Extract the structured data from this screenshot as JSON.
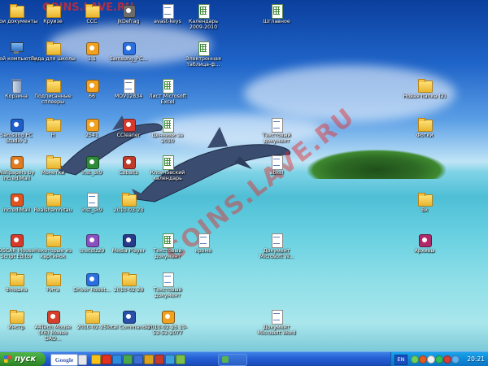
{
  "desktop": {
    "icons": [
      {
        "label": "Мои документы",
        "kind": "folder"
      },
      {
        "label": "Круизе",
        "kind": "folder"
      },
      {
        "label": "ССС",
        "kind": "folder"
      },
      {
        "label": "JkDefrag",
        "kind": "app",
        "color": "#6b6b6b"
      },
      {
        "label": "avast-keys",
        "kind": "doc"
      },
      {
        "label": "Календарь 2009-2010",
        "kind": "xls"
      },
      {
        "label": "Шглавное",
        "kind": "xls"
      },
      {
        "label": "Мой компьютер",
        "kind": "pc"
      },
      {
        "label": "Лида для школы",
        "kind": "folder"
      },
      {
        "label": "1.1",
        "kind": "app",
        "color": "#f2a01f"
      },
      {
        "label": "Samsung_PC...",
        "kind": "app",
        "color": "#2a6fe0"
      },
      {
        "label": "Электронная таблица-ф...",
        "kind": "xls"
      },
      {
        "label": "Корзина",
        "kind": "bin"
      },
      {
        "label": "Подписанные сплееры",
        "kind": "folder"
      },
      {
        "label": "66",
        "kind": "app",
        "color": "#f2a01f"
      },
      {
        "label": "MOV02834",
        "kind": "doc"
      },
      {
        "label": "Лист Microsoft Excel",
        "kind": "xls"
      },
      {
        "label": "Новая папка (2)",
        "kind": "folder"
      },
      {
        "label": "Samsung PC Studio 3",
        "kind": "app",
        "color": "#1f5fc9"
      },
      {
        "label": "Н",
        "kind": "folder"
      },
      {
        "label": "2541",
        "kind": "app",
        "color": "#f2a01f"
      },
      {
        "label": "CCleaner",
        "kind": "app",
        "color": "#d63a2a"
      },
      {
        "label": "Ценники за 2010",
        "kind": "xls"
      },
      {
        "label": "Текстовый документ",
        "kind": "doc"
      },
      {
        "label": "Фотки",
        "kind": "folder"
      },
      {
        "label": "Wallpapers by IncrediMail",
        "kind": "app",
        "color": "#e07b1f"
      },
      {
        "label": "Монетки",
        "kind": "folder"
      },
      {
        "label": "inst_sk9",
        "kind": "app",
        "color": "#2e8b3a"
      },
      {
        "label": "Cobalts",
        "kind": "app",
        "color": "#c03a2a"
      },
      {
        "label": "Клоичэвский календарь",
        "kind": "xls"
      },
      {
        "label": "abkill",
        "kind": "doc"
      },
      {
        "label": "IncrediMail",
        "kind": "app",
        "color": "#e0541f"
      },
      {
        "label": "Realshamnitau",
        "kind": "folder"
      },
      {
        "label": "inst_sk9",
        "kind": "doc"
      },
      {
        "label": "2010-03-23",
        "kind": "folder"
      },
      {
        "label": "Вк",
        "kind": "folder"
      },
      {
        "label": "OSCAR Mouse Script Editor",
        "kind": "app",
        "color": "#d63a2a"
      },
      {
        "label": "Некоторые из картинок",
        "kind": "folder"
      },
      {
        "label": "cnetdlz29",
        "kind": "app",
        "color": "#8a4fc0"
      },
      {
        "label": "Media Player",
        "kind": "app",
        "color": "#2a3a8a"
      },
      {
        "label": "Текстовый документ",
        "kind": "xls"
      },
      {
        "label": "кроме",
        "kind": "doc"
      },
      {
        "label": "Документ Microsoft W...",
        "kind": "doc"
      },
      {
        "label": "Архивы",
        "kind": "app",
        "color": "#b02a6a"
      },
      {
        "label": "Флешка",
        "kind": "folder"
      },
      {
        "label": "Рита",
        "kind": "folder"
      },
      {
        "label": "Driver Robot...",
        "kind": "app",
        "color": "#2a6fe0"
      },
      {
        "label": "2010-02-28",
        "kind": "folder"
      },
      {
        "label": "Текстовый документ",
        "kind": "doc"
      },
      {
        "label": "Инстр",
        "kind": "folder"
      },
      {
        "label": "A4Tech Mouse (X6) Mouse DAD...",
        "kind": "app",
        "color": "#d6402a"
      },
      {
        "label": "2010-02-25",
        "kind": "folder"
      },
      {
        "label": "Total Commander",
        "kind": "app",
        "color": "#2a4fa8"
      },
      {
        "label": "2010-02-26 19-53-53-2077",
        "kind": "app",
        "color": "#f2a01f"
      },
      {
        "label": "Документ Microsoft Word",
        "kind": "doc"
      }
    ],
    "watermark": "COINS.LAVE.RU",
    "watermark_top": "COINS.LAVE.RU"
  },
  "taskbar": {
    "start_label": "пуск",
    "google_label": "Google",
    "quick_launch": [
      {
        "name": "ie-icon",
        "color": "#f6c21a"
      },
      {
        "name": "opera-icon",
        "color": "#e2321f"
      },
      {
        "name": "mail-icon",
        "color": "#2f8be0"
      },
      {
        "name": "messenger-icon",
        "color": "#4aa84a"
      },
      {
        "name": "desktop-icon",
        "color": "#3b6fd6"
      },
      {
        "name": "player-icon",
        "color": "#d9a21f"
      },
      {
        "name": "cc-icon",
        "color": "#c63a2a"
      },
      {
        "name": "browser-icon",
        "color": "#3aa0e0"
      },
      {
        "name": "chat-icon",
        "color": "#7ac04a"
      }
    ],
    "language": "EN",
    "tray_icons": [
      {
        "name": "network-icon",
        "color": "#6ad05a"
      },
      {
        "name": "antivirus-icon",
        "color": "#e25a1f"
      },
      {
        "name": "volume-icon",
        "color": "#f0f0f0"
      },
      {
        "name": "update-icon",
        "color": "#2fc05a"
      },
      {
        "name": "shield-icon",
        "color": "#d63a3a"
      },
      {
        "name": "messenger-tray-icon",
        "color": "#5ab0f0"
      }
    ],
    "clock": "20:21"
  }
}
